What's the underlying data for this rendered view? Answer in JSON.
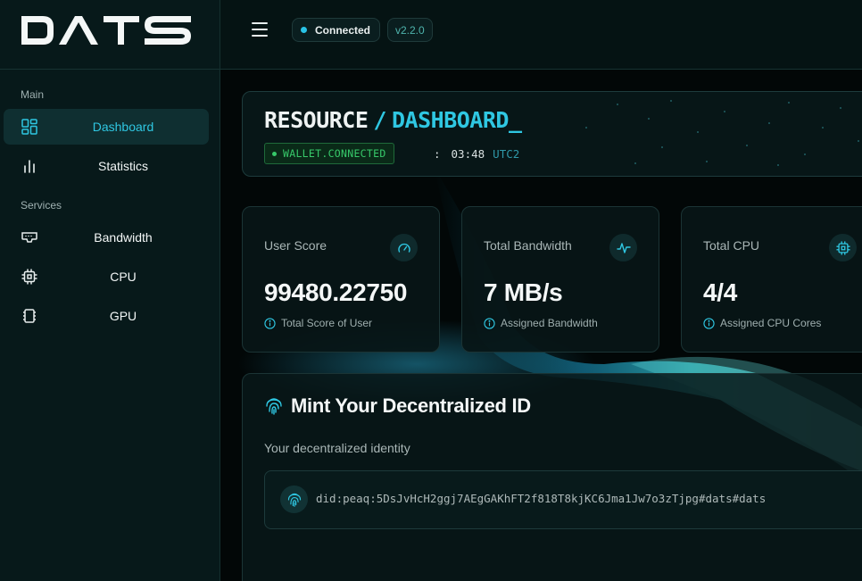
{
  "app": {
    "name": "DATS"
  },
  "sidebar": {
    "sections": [
      {
        "label": "Main"
      },
      {
        "label": "Services"
      }
    ],
    "items": [
      {
        "label": "Dashboard",
        "icon": "dashboard-grid-icon",
        "active": true
      },
      {
        "label": "Statistics",
        "icon": "bar-chart-icon"
      },
      {
        "label": "Bandwidth",
        "icon": "router-icon"
      },
      {
        "label": "CPU",
        "icon": "cpu-chip-icon"
      },
      {
        "label": "GPU",
        "icon": "gpu-card-icon"
      }
    ]
  },
  "topbar": {
    "status": "Connected",
    "version": "v2.2.0",
    "status_color": "#29c3e6"
  },
  "hero": {
    "title_part1": "RESOURCE",
    "separator": "/",
    "title_part2": "DASHBOARD",
    "cursor": "_",
    "wallet_status": "WALLET.CONNECTED",
    "time_sep": ":",
    "time": "03:48",
    "timezone": "UTC2"
  },
  "cards": [
    {
      "title": "User Score",
      "value": "99480.22750",
      "subtitle": "Total Score of User",
      "icon": "gauge-icon"
    },
    {
      "title": "Total Bandwidth",
      "value": "7 MB/s",
      "subtitle": "Assigned Bandwidth",
      "icon": "activity-pulse-icon"
    },
    {
      "title": "Total CPU",
      "value": "4/4",
      "subtitle": "Assigned CPU Cores",
      "icon": "cpu-icon"
    }
  ],
  "mint": {
    "title": "Mint Your Decentralized ID",
    "subtitle": "Your decentralized identity",
    "did": "did:peaq:5DsJvHcH2ggj7AEgGAKhFT2f818T8kjKC6Jma1Jw7o3zTjpg#dats#dats"
  },
  "colors": {
    "accent": "#2fc7e2",
    "wallet_green": "#37c96a",
    "background": "#020606"
  }
}
